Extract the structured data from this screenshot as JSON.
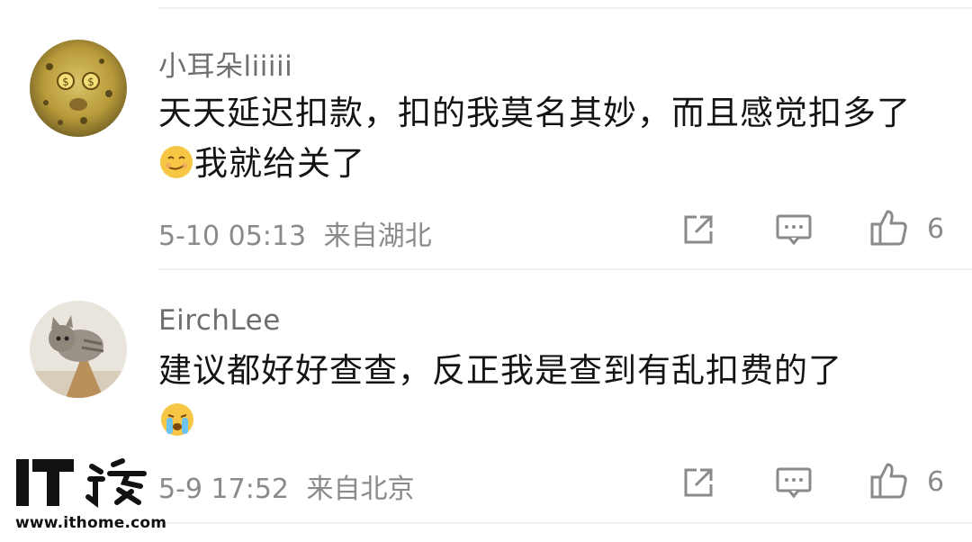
{
  "comments": [
    {
      "username": "小耳朵liiiii",
      "text_part1": "天天延迟扣款，扣的我莫名其妙，而且感觉扣多了",
      "emoji_inline": "smirk-face",
      "text_part2": "我就给关了",
      "timestamp": "5-10 05:13",
      "location": "来自湖北",
      "likes": "6"
    },
    {
      "username": "EirchLee",
      "text_part1": "建议都好好查查，反正我是查到有乱扣费的了",
      "emoji_inline": "crying-face",
      "text_part2": "",
      "timestamp": "5-9 17:52",
      "location": "来自北京",
      "likes": "6"
    }
  ],
  "watermark": {
    "brand_text": "IT之家",
    "url": "www.ithome.com"
  },
  "colors": {
    "text": "#141414",
    "username": "#6f6f6f",
    "meta": "#8a8a8a",
    "divider": "#f0f0f0",
    "icon": "#8a8a8a",
    "emoji_yellow": "#f6c644"
  },
  "icons": [
    "share-icon",
    "comment-icon",
    "thumbs-up-icon"
  ]
}
